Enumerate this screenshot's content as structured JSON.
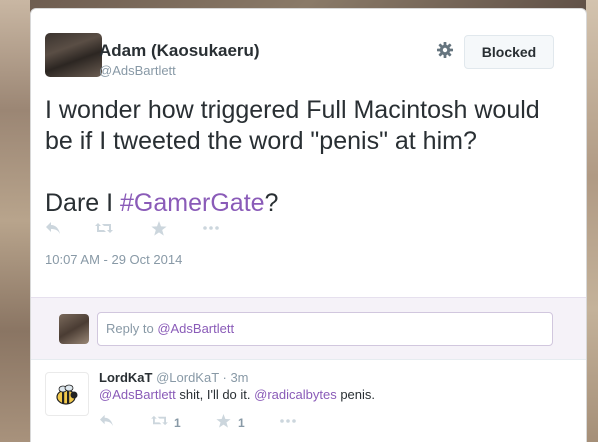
{
  "tweet": {
    "author_name": "Adam (Kaosukaeru)",
    "author_handle": "@AdsBartlett",
    "blocked_label": "Blocked",
    "text_line_1": "I wonder how triggered Full Macintosh would",
    "text_line_2": "be if I tweeted the word \"penis\" at him?",
    "text_line_3_prefix": "Dare I ",
    "hashtag": "#GamerGate",
    "text_line_3_suffix": "?",
    "timestamp": "10:07 AM - 29 Oct 2014",
    "icons": [
      "reply-icon",
      "retweet-icon",
      "favorite-icon",
      "more-icon"
    ]
  },
  "reply_box": {
    "prefix": "Reply to ",
    "mention": "@AdsBartlett"
  },
  "reply": {
    "name": "LordKaT",
    "meta": "@LordKaT · 3m",
    "mention_1": "@AdsBartlett",
    "text_mid": " shit, I'll do it. ",
    "mention_2": "@radicalbytes",
    "text_end": " penis.",
    "retweet_count": "1",
    "favorite_count": "1"
  },
  "colors": {
    "accent": "#8a5bb8",
    "text": "#292f33",
    "muted": "#8899a6",
    "icon": "#ccd6dd"
  }
}
